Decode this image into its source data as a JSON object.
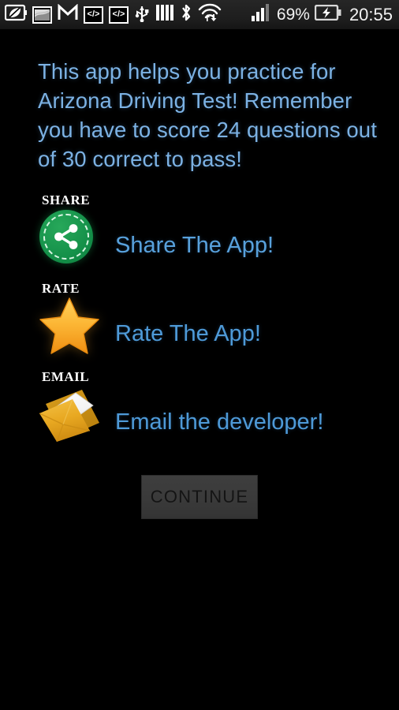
{
  "statusbar": {
    "icons": [
      {
        "name": "eco-leaf-battery-icon",
        "glyph": "leaf"
      },
      {
        "name": "photo-image-icon",
        "glyph": "photo"
      },
      {
        "name": "gmail-icon",
        "glyph": "M"
      },
      {
        "name": "code-icon-1",
        "glyph": "</>"
      },
      {
        "name": "code-icon-2",
        "glyph": "</>"
      },
      {
        "name": "usb-icon",
        "glyph": "usb"
      },
      {
        "name": "sim-bars-icon",
        "glyph": "bars"
      },
      {
        "name": "bluetooth-icon",
        "glyph": "bt"
      },
      {
        "name": "wifi-transfer-icon",
        "glyph": "wifi"
      },
      {
        "name": "cellular-signal-icon",
        "glyph": "signal"
      }
    ],
    "battery_percent": "69%",
    "battery_state": "charging",
    "clock": "20:55"
  },
  "content": {
    "headline": "This app helps you practice for Arizona Driving Test! Remember you have to score 24 questions out of 30 correct to pass!",
    "pass_score": 24,
    "total_questions": 30
  },
  "actions": [
    {
      "id": "share",
      "caption": "SHARE",
      "label": "Share The App!",
      "icon": "share-nodes-icon",
      "color": "#149049"
    },
    {
      "id": "rate",
      "caption": "RATE",
      "label": "Rate The App!",
      "icon": "star-icon",
      "color": "#f9b233"
    },
    {
      "id": "email",
      "caption": "EMAIL",
      "label": "Email the developer!",
      "icon": "envelope-icon",
      "color": "#e8a321"
    }
  ],
  "footer": {
    "continue_label": "CONTINUE"
  },
  "theme": {
    "background": "#000000",
    "text_blue": "#4e9ad8",
    "headline_blue": "#7cb2e4",
    "statusbar_bg": "#1d1d1d",
    "button_bg": "#3a3a3a"
  }
}
